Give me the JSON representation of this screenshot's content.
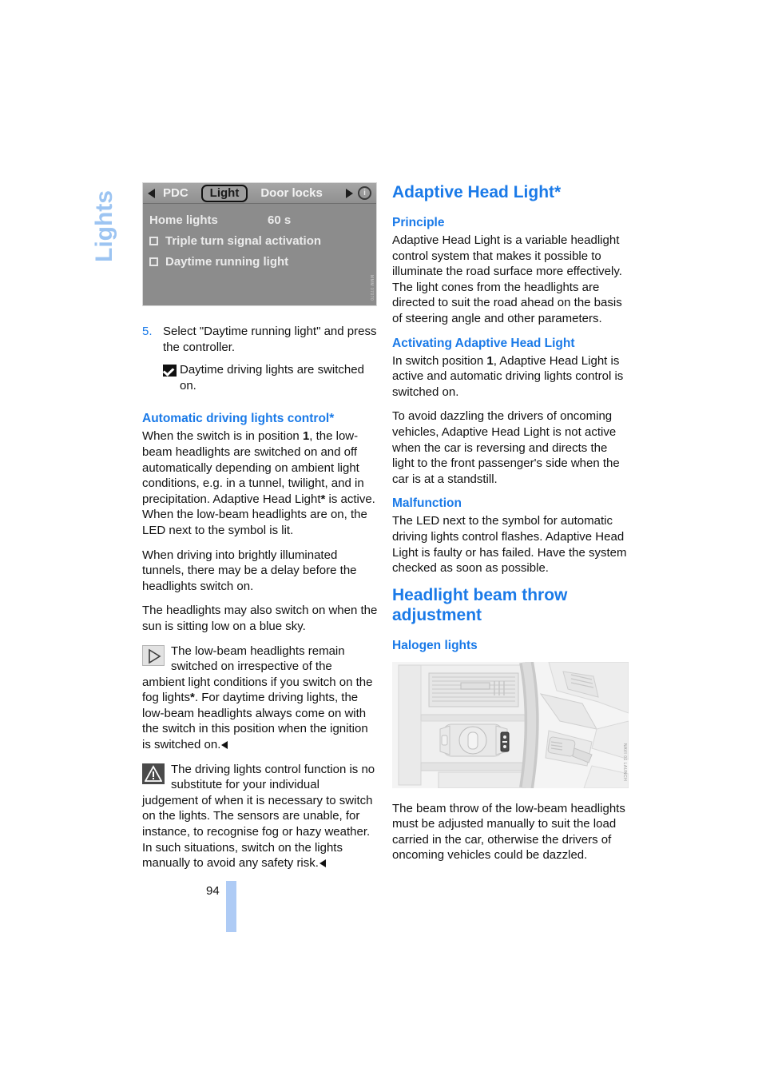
{
  "chapter": {
    "tab_label": "Lights"
  },
  "page": {
    "number": "94"
  },
  "idrive_screen": {
    "nav": {
      "prev_icon": "left-arrow-icon",
      "items": [
        "PDC",
        "Light",
        "Door locks"
      ],
      "selected": "Light",
      "next_icon": "right-arrow-icon",
      "info_icon": "info-icon"
    },
    "rows": [
      {
        "label": "Home lights",
        "value": "60 s",
        "has_checkbox": false
      },
      {
        "label": "Triple turn signal activation",
        "value": "",
        "has_checkbox": true
      },
      {
        "label": "Daytime running light",
        "value": "",
        "has_checkbox": true
      }
    ],
    "credit": "MMM 07070"
  },
  "left_column": {
    "step": {
      "number": "5.",
      "text": "Select \"Daytime running light\" and press the controller."
    },
    "result": {
      "icon": "checkbox-checked-icon",
      "text": "Daytime driving lights are switched on."
    },
    "section_heading": "Automatic driving lights control*",
    "paragraph_1_a": "When the switch is in position ",
    "paragraph_1_b": "1",
    "paragraph_1_c": ", the low-beam headlights are switched on and off automatically depending on ambient light conditions, e.g. in a tunnel, twilight, and in precipitation. Adaptive Head Light",
    "paragraph_1_d": "*",
    "paragraph_1_e": " is active. When the low-beam headlights are on, the LED next to the symbol is lit.",
    "paragraph_2": "When driving into brightly illuminated tunnels, there may be a delay before the headlights switch on.",
    "paragraph_3": "The headlights may also switch on when the sun is sitting low on a blue sky.",
    "note": {
      "icon": "note-triangle-icon",
      "text_a": "The low-beam headlights remain switched on irrespective of the ambient light conditions if you switch on the fog lights",
      "text_b": "*",
      "text_c": ". For daytime driving lights, the low-beam headlights always come on with the switch in this position when the ignition is switched on."
    },
    "warning": {
      "icon": "warning-triangle-icon",
      "text": "The driving lights control function is no substitute for your individual judgement of when it is necessary to switch on the lights. The sensors are unable, for instance, to recognise fog or hazy weather. In such situations, switch on the lights manually to avoid any safety risk."
    }
  },
  "right_column": {
    "title": "Adaptive Head Light*",
    "principle_heading": "Principle",
    "principle_text": "Adaptive Head Light is a variable headlight control system that makes it possible to illuminate the road surface more effectively. The light cones from the headlights are directed to suit the road ahead on the basis of steering angle and other parameters.",
    "activating_heading": "Activating Adaptive Head Light",
    "activating_text_a": "In switch position ",
    "activating_text_b": "1",
    "activating_text_c": ", Adaptive Head Light is active and automatic driving lights control is switched on.",
    "activating_text_2": "To avoid dazzling the drivers of oncoming vehicles, Adaptive Head Light is not active when the car is reversing and directs the light to the front passenger's side when the car is at a standstill.",
    "malfunction_heading": "Malfunction",
    "malfunction_text": "The LED next to the symbol for automatic driving lights control flashes. Adaptive Head Light is faulty or has failed. Have the system checked as soon as possible.",
    "beam_title_line1": "Headlight beam throw",
    "beam_title_line2": "adjustment",
    "halogen_heading": "Halogen lights",
    "figure": {
      "name": "dashboard-light-switch-illustration",
      "credit": "NAVI 01 LAUNCH"
    },
    "beam_text": "The beam throw of the low-beam headlights must be adjusted manually to suit the load carried in the car, otherwise the drivers of oncoming vehicles could be dazzled."
  },
  "colors": {
    "heading_blue": "#1a7ae8",
    "tab_blue": "#9cc4f2",
    "page_bar_blue": "#aecbf5"
  }
}
